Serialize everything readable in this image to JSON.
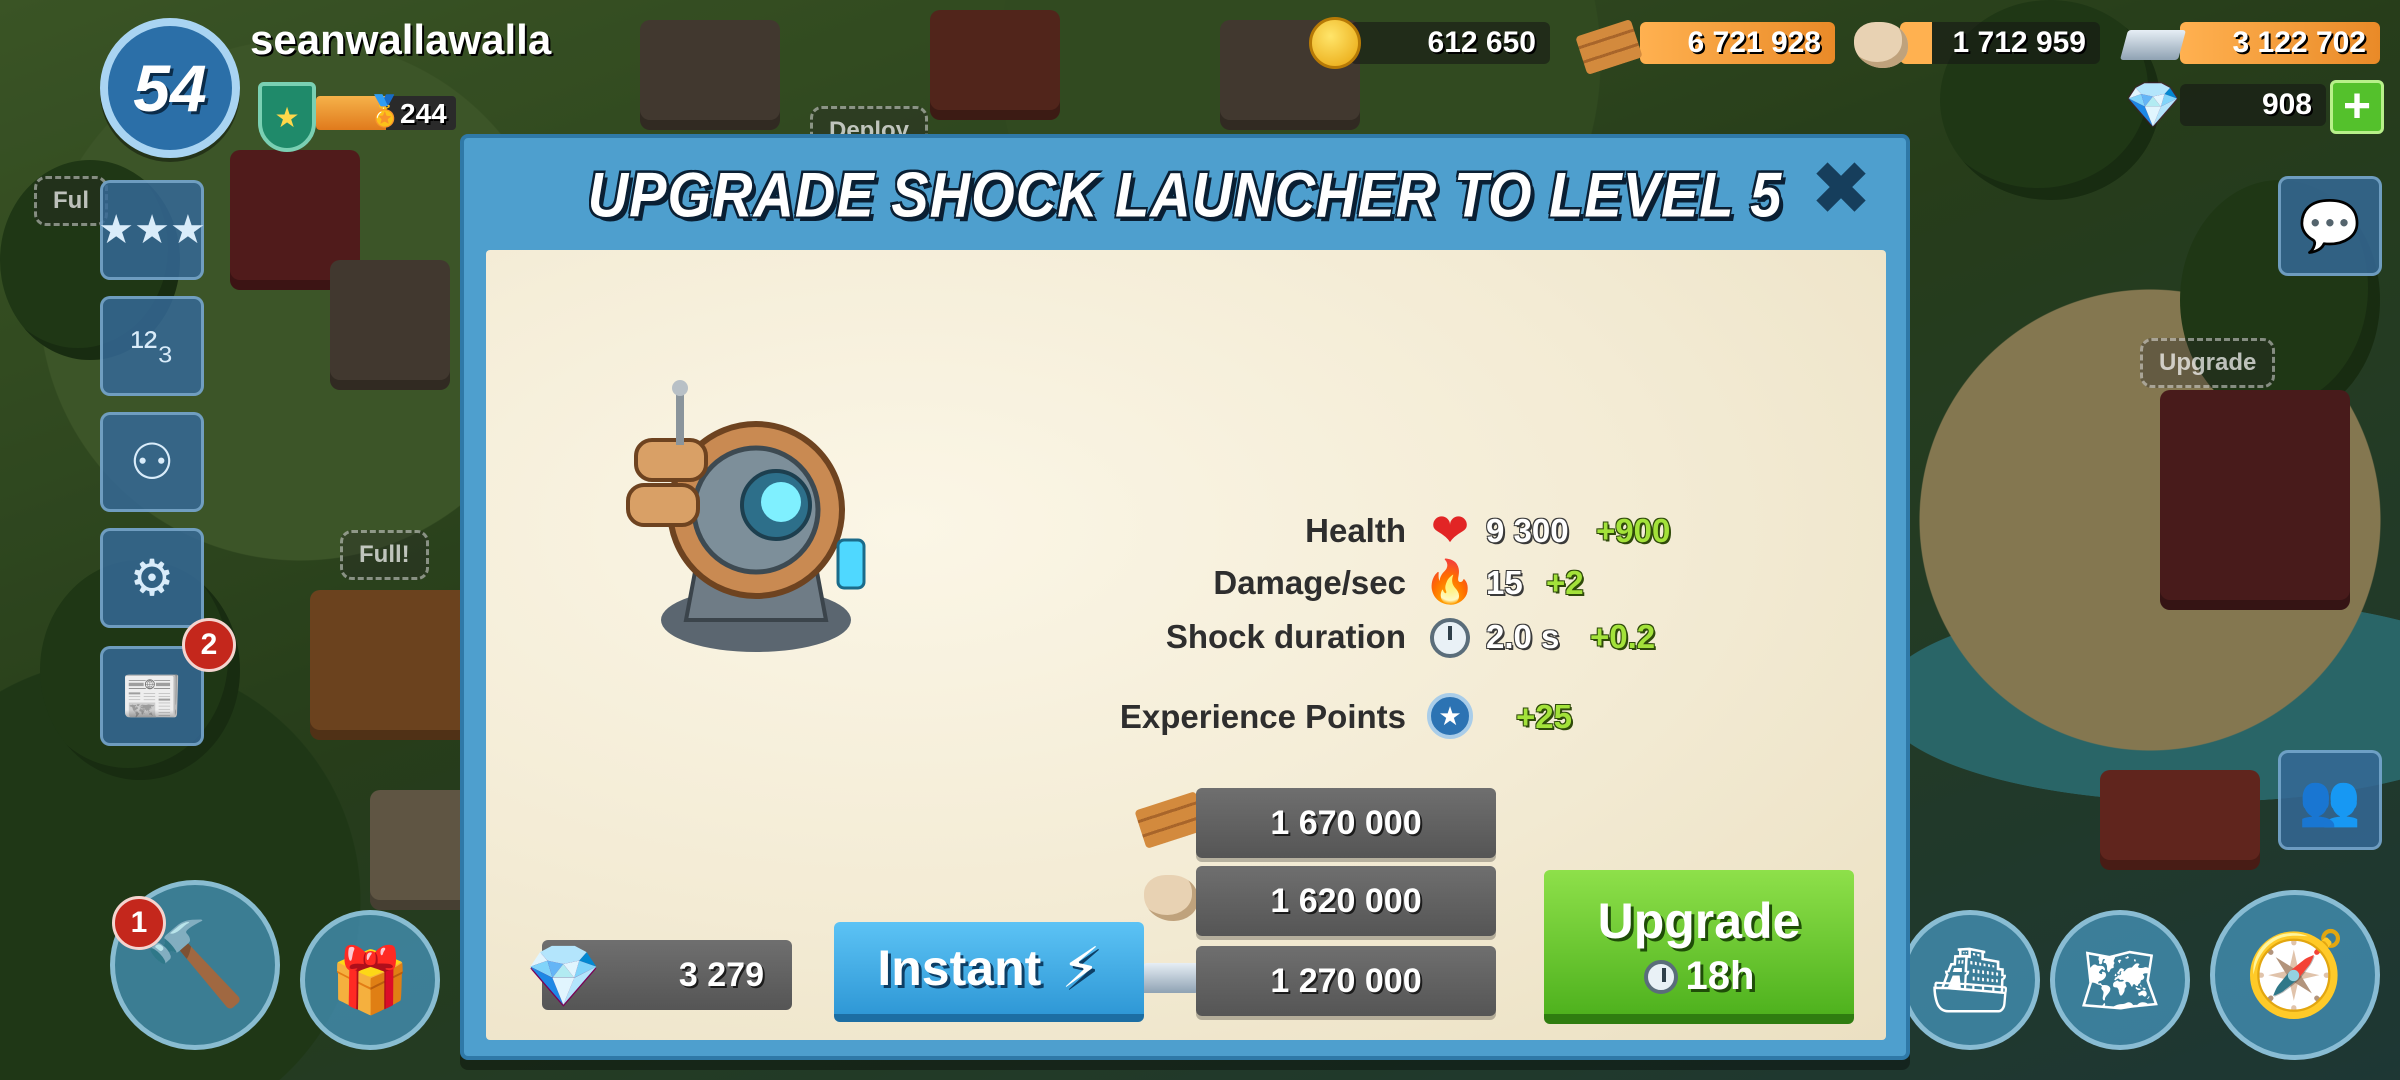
{
  "player": {
    "level": "54",
    "name": "seanwallawalla",
    "victory_points": "244"
  },
  "resources": {
    "gold": "612 650",
    "wood": "6 721 928",
    "stone": "1 712 959",
    "iron": "3 122 702",
    "gems": "908"
  },
  "world_labels": {
    "deploy": "Deploy",
    "full_1": "Ful",
    "full_2": "Full!",
    "upgrade": "Upgrade"
  },
  "badges": {
    "reports_count": "2",
    "builder_count": "1"
  },
  "modal": {
    "title": "UPGRADE SHOCK LAUNCHER TO LEVEL 5",
    "stats": [
      {
        "label": "Health",
        "icon": "heart-icon",
        "value": "9 300",
        "bonus": "+900"
      },
      {
        "label": "Damage/sec",
        "icon": "fire-icon",
        "value": "15",
        "bonus": "+2"
      },
      {
        "label": "Shock duration",
        "icon": "stopwatch-icon",
        "value": "2.0 s",
        "bonus": "+0.2"
      },
      {
        "label": "Experience Points",
        "icon": "xp-star-icon",
        "value": "",
        "bonus": "+25"
      }
    ],
    "costs": {
      "wood": "1 670 000",
      "stone": "1 620 000",
      "iron": "1 270 000"
    },
    "gem_cost": "3 279",
    "instant_label": "Instant",
    "upgrade_label": "Upgrade",
    "upgrade_time": "18h"
  },
  "colors": {
    "modal_blue": "#4e9fce",
    "upgrade_green": "#5cbf25",
    "instant_blue": "#3aa7e2",
    "bonus_green": "#a3e23a"
  }
}
